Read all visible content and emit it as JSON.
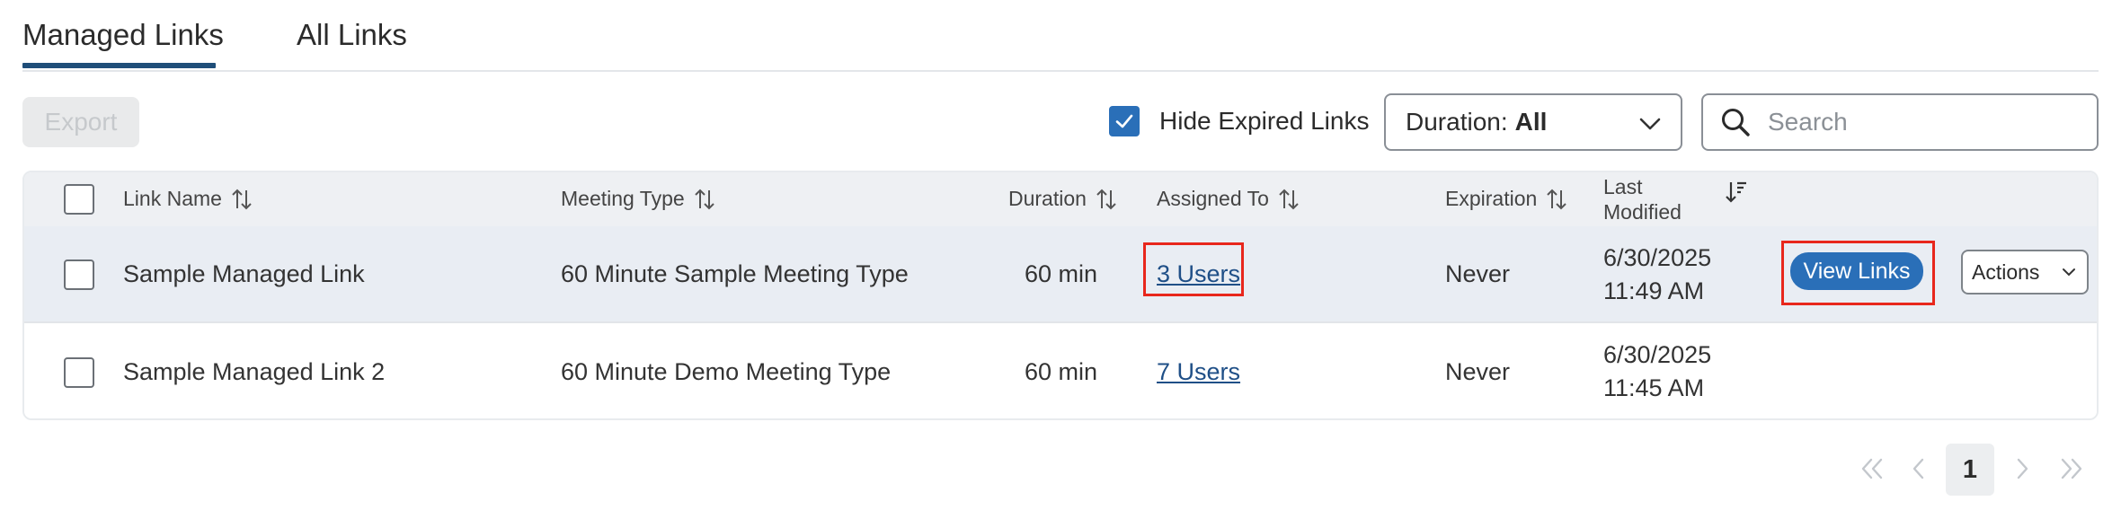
{
  "tabs": [
    {
      "label": "Managed Links",
      "active": true
    },
    {
      "label": "All Links",
      "active": false
    }
  ],
  "toolbar": {
    "export_label": "Export",
    "hide_expired_label": "Hide Expired Links",
    "hide_expired_checked": true,
    "duration_prefix": "Duration:",
    "duration_value": "All",
    "search_placeholder": "Search"
  },
  "table": {
    "headers": {
      "link_name": "Link Name",
      "meeting_type": "Meeting Type",
      "duration": "Duration",
      "assigned_to": "Assigned To",
      "expiration": "Expiration",
      "last_modified_line1": "Last",
      "last_modified_line2": "Modified"
    },
    "rows": [
      {
        "link_name": "Sample Managed Link",
        "meeting_type": "60 Minute Sample Meeting Type",
        "duration": "60 min",
        "assigned_to": "3 Users",
        "expiration": "Never",
        "modified_date": "6/30/2025",
        "modified_time": "11:49 AM",
        "view_label": "View Links",
        "actions_label": "Actions"
      },
      {
        "link_name": "Sample Managed Link 2",
        "meeting_type": "60 Minute Demo Meeting Type",
        "duration": "60 min",
        "assigned_to": "7 Users",
        "expiration": "Never",
        "modified_date": "6/30/2025",
        "modified_time": "11:45 AM"
      }
    ]
  },
  "pagination": {
    "current_page": "1"
  },
  "colors": {
    "accent": "#2a6fb8",
    "tab_underline": "#1f4e79",
    "highlight": "#e8271c",
    "link": "#1f4f87"
  }
}
